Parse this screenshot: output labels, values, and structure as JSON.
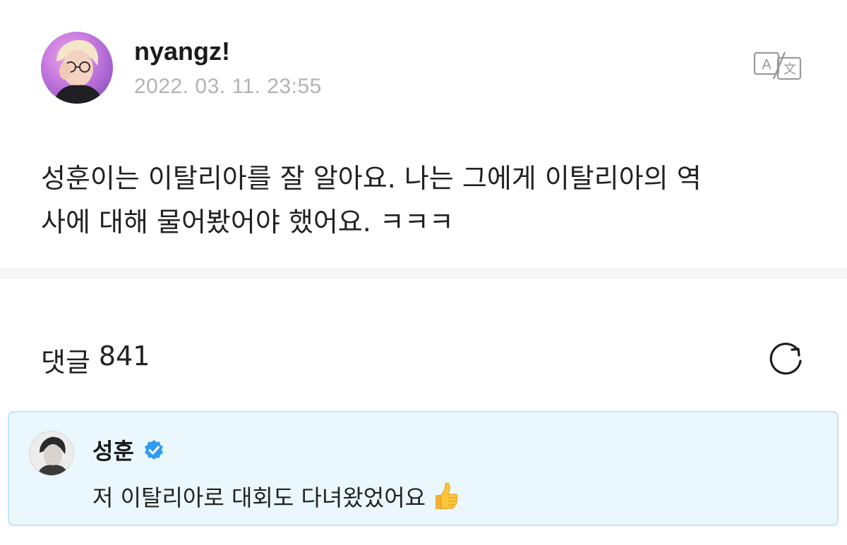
{
  "post": {
    "author": "nyangz!",
    "date": "2022. 03. 11. 23:55",
    "body_line1": "성훈이는 이탈리아를 잘 알아요. 나는 그에게 이탈리아의 역",
    "body_line2": "사에 대해 물어봤어야 했어요. ㅋㅋㅋ",
    "translate_icon": "translate-icon"
  },
  "comments": {
    "label": "댓글",
    "count": "841",
    "refresh_icon": "refresh-icon",
    "pinned": {
      "author": "성훈",
      "verified": true,
      "text": "저 이탈리아로 대회도 다녀왔었어요",
      "emoji": "thumbs-up",
      "background": "#eaf7fd",
      "border": "#bfe6f5"
    }
  },
  "colors": {
    "verified_badge": "#2e9cf3",
    "muted_text": "#b3b3b3"
  }
}
